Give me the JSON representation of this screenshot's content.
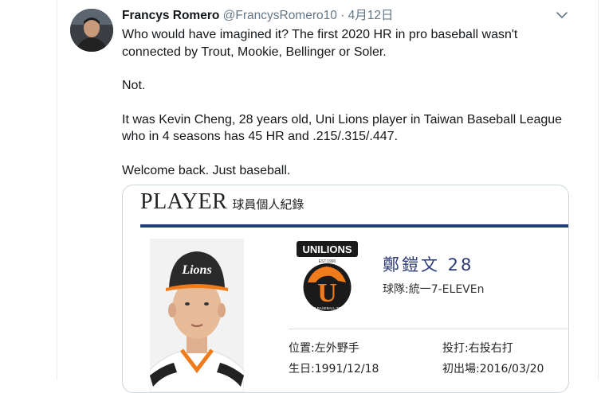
{
  "tweet": {
    "author_name": "Francys Romero",
    "author_handle": "@FrancysRomero10",
    "separator": "·",
    "date": "4月12日",
    "paragraphs": [
      "Who would have imagined it? The first 2020 HR in pro baseball wasn't connected by Trout, Mookie, Bellinger or Soler.",
      "Not.",
      "It was Kevin Cheng, 28 years old, Uni Lions player in Taiwan Baseball League who in 4 seasons has 45 HR and .215/.315/.447.",
      "Welcome back. Just baseball."
    ]
  },
  "card": {
    "title": "PLAYER",
    "subtitle": "球員個人紀錄",
    "player_name": "鄭鎧文 28",
    "team": "球隊:統一7-ELEVEn",
    "photo_cap_text": "Lions",
    "logo_text": "UNILIONS",
    "logo_year": "EST.1990",
    "logo_letter": "U",
    "logo_bottom": "PRO BASEBALL TEAM",
    "position": "位置:左外野手",
    "throws_bats": "投打:右投右打",
    "birth": "生日:1991/12/18",
    "debut": "初出場:2016/03/20"
  },
  "colors": {
    "text": "#14171a",
    "secondary": "#657786",
    "navy": "#1f3f73",
    "player_name": "#2c3b77",
    "orange": "#ef7b1a"
  },
  "icons": [
    "chevron-down-icon"
  ]
}
